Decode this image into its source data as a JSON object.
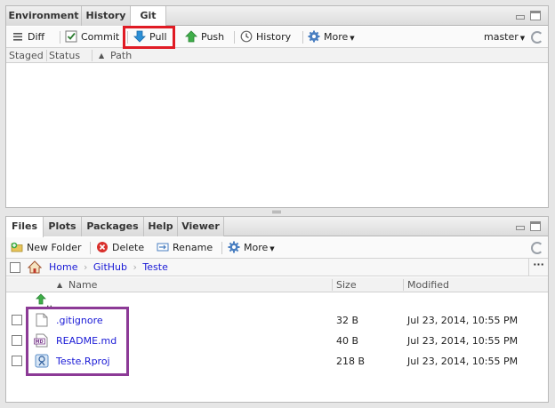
{
  "git_pane": {
    "tabs": [
      {
        "label": "Environment",
        "active": false
      },
      {
        "label": "History",
        "active": false
      },
      {
        "label": "Git",
        "active": true
      }
    ],
    "toolbar": {
      "diff": "Diff",
      "commit": "Commit",
      "pull": "Pull",
      "push": "Push",
      "history": "History",
      "more": "More",
      "branch": "master"
    },
    "columns": {
      "staged": "Staged",
      "status": "Status",
      "path": "Path"
    }
  },
  "files_pane": {
    "tabs": [
      {
        "label": "Files",
        "active": true
      },
      {
        "label": "Plots",
        "active": false
      },
      {
        "label": "Packages",
        "active": false
      },
      {
        "label": "Help",
        "active": false
      },
      {
        "label": "Viewer",
        "active": false
      }
    ],
    "toolbar": {
      "new_folder": "New Folder",
      "delete": "Delete",
      "rename": "Rename",
      "more": "More"
    },
    "breadcrumb": [
      "Home",
      "GitHub",
      "Teste"
    ],
    "columns": {
      "name": "Name",
      "size": "Size",
      "modified": "Modified"
    },
    "parent_dir": "..",
    "files": [
      {
        "name": ".gitignore",
        "size": "32 B",
        "modified": "Jul 23, 2014, 10:55 PM",
        "icon": "text-file-icon"
      },
      {
        "name": "README.md",
        "size": "40 B",
        "modified": "Jul 23, 2014, 10:55 PM",
        "icon": "markdown-file-icon"
      },
      {
        "name": "Teste.Rproj",
        "size": "218 B",
        "modified": "Jul 23, 2014, 10:55 PM",
        "icon": "rproj-file-icon"
      }
    ]
  },
  "colors": {
    "pull_highlight": "#e01b24",
    "files_highlight": "#8c3a96",
    "link": "#1a1ad6"
  }
}
